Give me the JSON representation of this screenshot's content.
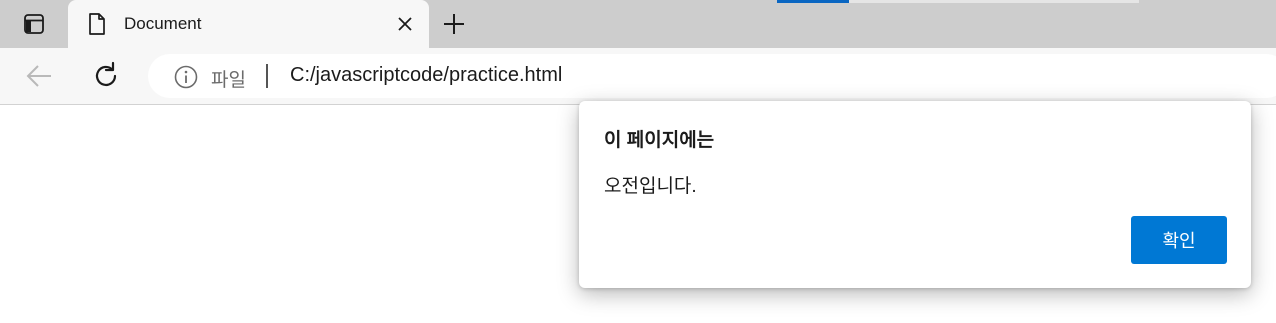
{
  "browser": {
    "tab": {
      "title": "Document"
    },
    "address_bar": {
      "scheme_label": "파일",
      "url": "C:/javascriptcode/practice.html"
    }
  },
  "dialog": {
    "title": "이 페이지에는",
    "message": "오전입니다.",
    "ok_label": "확인"
  },
  "colors": {
    "accent": "#0078d4",
    "tabstrip_bg": "#cdcdcd",
    "toolbar_bg": "#f7f7f7"
  },
  "icons": {
    "tab_actions": "tab-actions-icon",
    "favicon": "document-icon",
    "close": "close-icon",
    "new_tab": "plus-icon",
    "back": "back-arrow-icon",
    "reload": "reload-icon",
    "info": "info-icon"
  }
}
